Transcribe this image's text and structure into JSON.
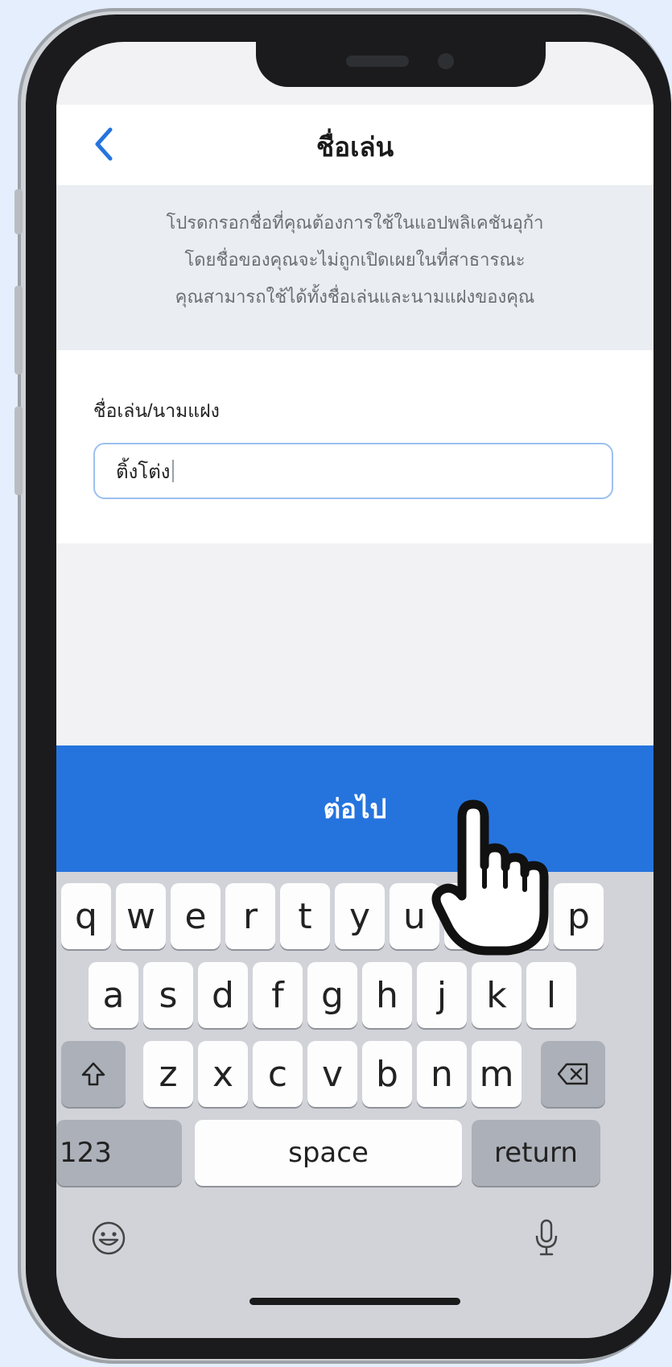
{
  "nav": {
    "title": "ชื่อเล่น"
  },
  "info": {
    "lines": [
      "โปรดกรอกชื่อที่คุณต้องการใช้ในแอปพลิเคชันอุก้า",
      "โดยชื่อของคุณจะไม่ถูกเปิดเผยในที่สาธารณะ",
      "คุณสามารถใช้ได้ทั้งชื่อเล่นและนามแฝงของคุณ"
    ]
  },
  "form": {
    "label": "ชื่อเล่น/นามแฝง",
    "value": "ติ้งโต่ง"
  },
  "primary_button": {
    "label": "ต่อไป"
  },
  "keyboard": {
    "row1": [
      "q",
      "w",
      "e",
      "r",
      "t",
      "y",
      "u",
      "i",
      "o",
      "p"
    ],
    "row2": [
      "a",
      "s",
      "d",
      "f",
      "g",
      "h",
      "j",
      "k",
      "l"
    ],
    "row3": [
      "z",
      "x",
      "c",
      "v",
      "b",
      "n",
      "m"
    ],
    "numbers_label": "123",
    "space_label": "space",
    "return_label": "return"
  },
  "colors": {
    "accent": "#2574de",
    "input_border": "#9cc0f0",
    "background": "#e4eefc"
  }
}
